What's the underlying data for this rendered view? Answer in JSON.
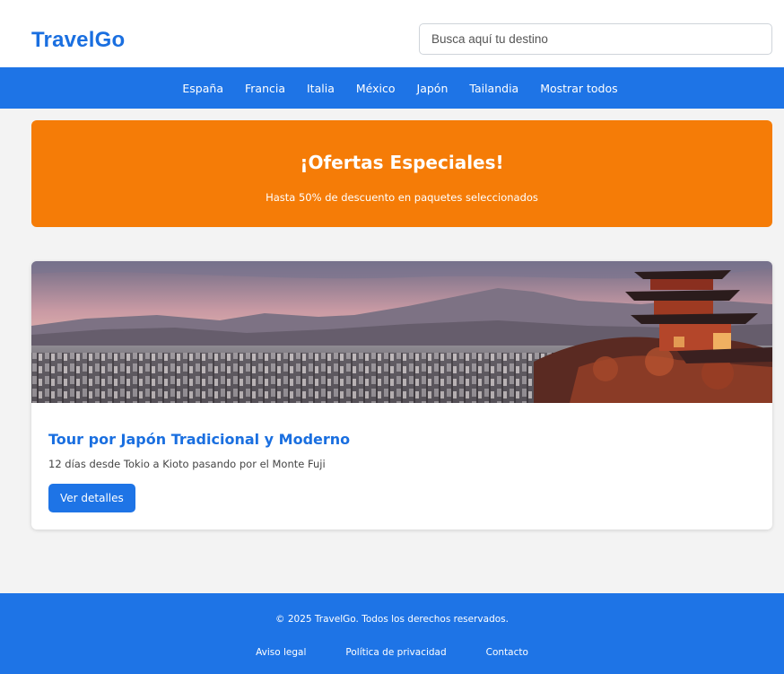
{
  "header": {
    "logo": "TravelGo",
    "search_placeholder": "Busca aquí tu destino"
  },
  "nav": {
    "items": [
      "España",
      "Francia",
      "Italia",
      "México",
      "Japón",
      "Tailandia",
      "Mostrar todos"
    ]
  },
  "banner": {
    "title": "¡Ofertas Especiales!",
    "subtitle": "Hasta 50% de descuento en paquetes seleccionados",
    "color": "#f57c07"
  },
  "card": {
    "image_alt": "Kyoto pagoda at sunset over city and mountains",
    "title": "Tour por Japón Tradicional y Moderno",
    "description": "12 días desde Tokio a Kioto pasando por el Monte Fuji",
    "button_label": "Ver detalles"
  },
  "footer": {
    "copyright": "© 2025 TravelGo. Todos los derechos reservados.",
    "links": [
      "Aviso legal",
      "Política de privacidad",
      "Contacto"
    ]
  },
  "colors": {
    "primary": "#1e74e6",
    "accent": "#f57c07",
    "background": "#f3f3f3"
  }
}
